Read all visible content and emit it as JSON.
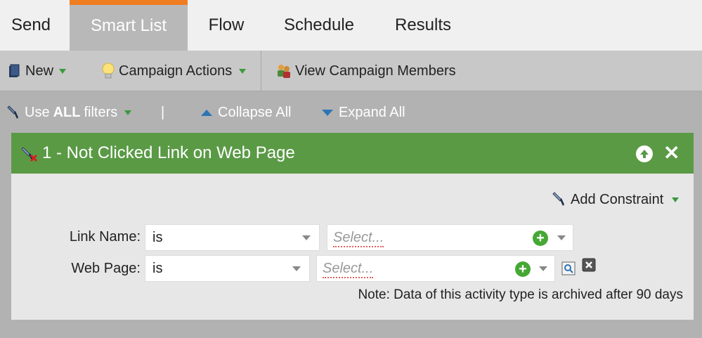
{
  "tabs": [
    {
      "label": "Send"
    },
    {
      "label": "Smart List"
    },
    {
      "label": "Flow"
    },
    {
      "label": "Schedule"
    },
    {
      "label": "Results"
    }
  ],
  "toolbar": {
    "new_label": "New",
    "campaign_actions_label": "Campaign Actions",
    "view_members_label": "View Campaign Members"
  },
  "filterbar": {
    "use_prefix": "Use",
    "use_all": "ALL",
    "use_suffix": "filters",
    "pipe": "|",
    "collapse_label": "Collapse All",
    "expand_label": "Expand All"
  },
  "filter": {
    "title": "1 - Not Clicked Link on Web Page",
    "add_constraint_label": "Add Constraint",
    "rows": [
      {
        "label": "Link Name:",
        "operator": "is",
        "placeholder": "Select..."
      },
      {
        "label": "Web Page:",
        "operator": "is",
        "placeholder": "Select..."
      }
    ],
    "note": "Note: Data of this activity type is archived after 90 days"
  },
  "colors": {
    "active_tab_accent": "#f07d1f",
    "filter_header": "#5a9a45",
    "caret_green": "#3a9b3a",
    "triangle_blue": "#2e74b5"
  }
}
